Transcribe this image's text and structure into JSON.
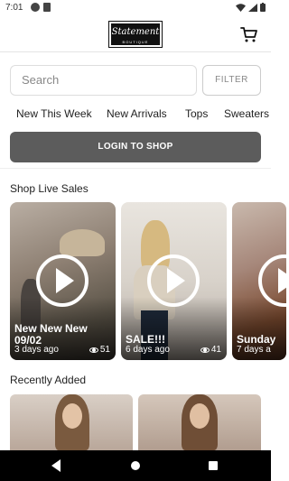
{
  "status_bar": {
    "time": "7:01"
  },
  "header": {
    "logo_script": "Statement",
    "logo_sub": "BOUTIQUE",
    "cart_icon": "cart-icon"
  },
  "search": {
    "placeholder": "Search",
    "filter_label": "FILTER"
  },
  "categories": [
    "New This Week",
    "New Arrivals",
    "Tops",
    "Sweaters"
  ],
  "login": {
    "label": "LOGIN TO SHOP"
  },
  "live_sales": {
    "title": "Shop Live Sales",
    "cards": [
      {
        "title": "New New New 09/02",
        "ago": "3 days ago",
        "views": "51"
      },
      {
        "title": "SALE!!!",
        "ago": "6 days ago",
        "views": "41"
      },
      {
        "title": "Sunday",
        "ago": "7 days a"
      }
    ]
  },
  "recently_added": {
    "title": "Recently Added"
  },
  "colors": {
    "login_bg": "#5c5c5c",
    "nav_bar_bg": "#000000"
  }
}
